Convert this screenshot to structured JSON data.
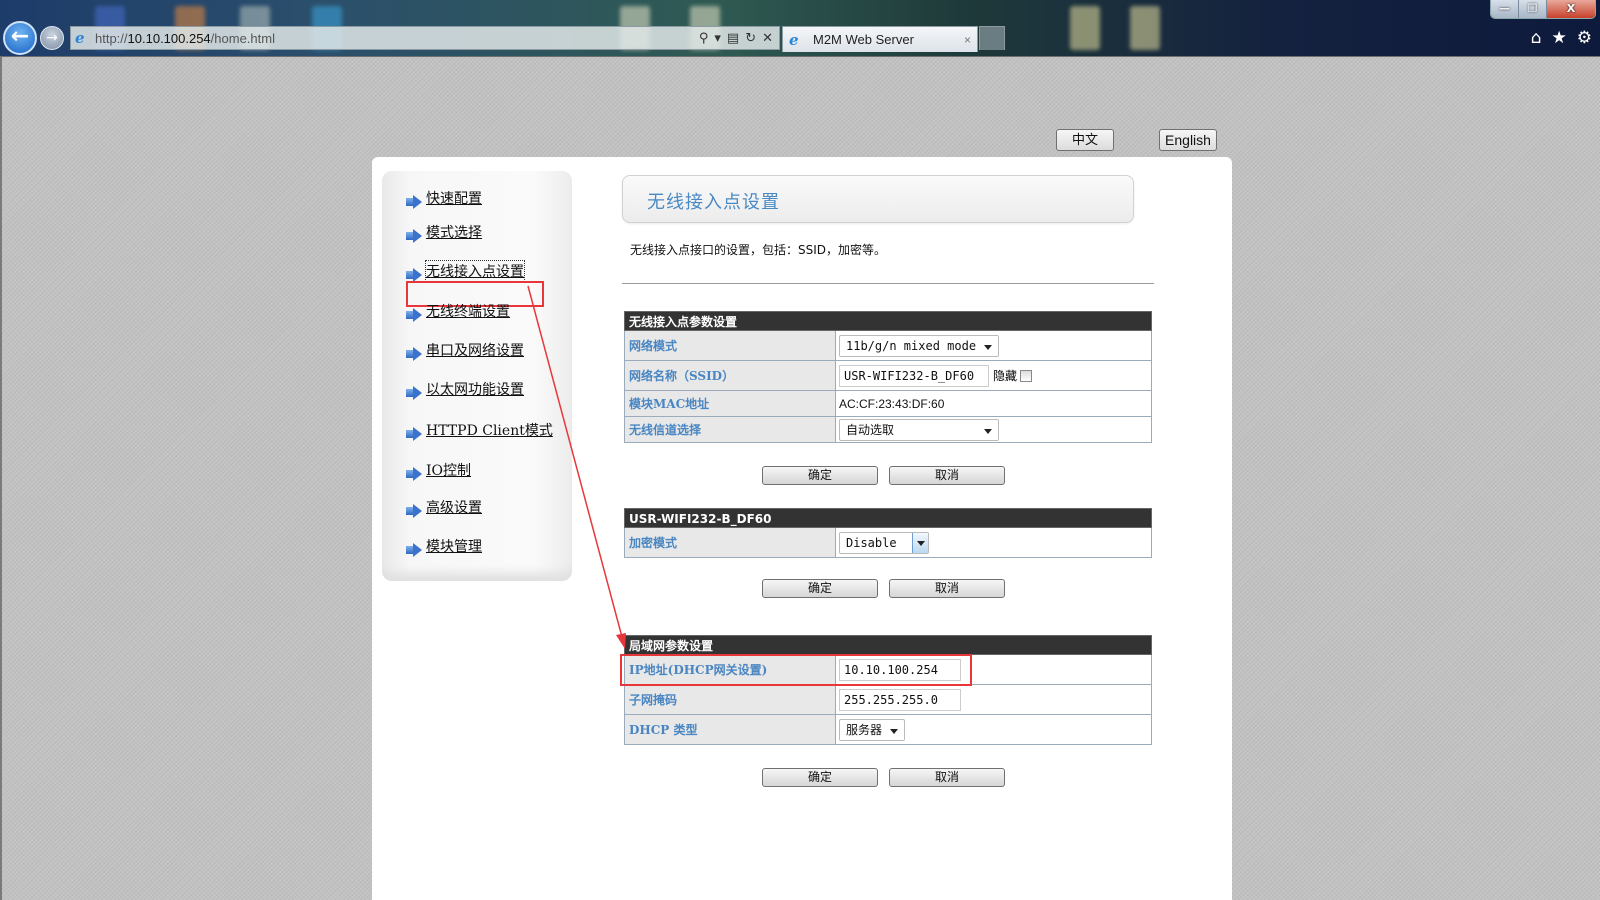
{
  "browser": {
    "url_prefix": "http://",
    "url_host": "10.10.100.254",
    "url_path": "/home.html",
    "tab_title": "M2M Web Server",
    "tab_close": "×",
    "back_glyph": "←",
    "forward_glyph": "→",
    "ie_glyph": "e",
    "addr_tools": {
      "search": "⚲",
      "dropdown": "▾",
      "compat": "▤",
      "refresh": "↻",
      "stop": "✕"
    },
    "window_buttons": {
      "minimize": "—",
      "restore": "❐",
      "close": "X"
    },
    "toolbar_icons": {
      "home": "⌂",
      "favorites": "★",
      "tools": "⚙"
    }
  },
  "language": {
    "chinese": "中文",
    "english": "English"
  },
  "sidebar": {
    "items": [
      {
        "label": "快速配置"
      },
      {
        "label": "模式选择"
      },
      {
        "label": "无线接入点设置",
        "active": true
      },
      {
        "label": "无线终端设置"
      },
      {
        "label": "串口及网络设置"
      },
      {
        "label": "以太网功能设置"
      },
      {
        "label": "HTTPD Client模式"
      },
      {
        "label": "IO控制"
      },
      {
        "label": "高级设置"
      },
      {
        "label": "模块管理"
      }
    ]
  },
  "main": {
    "title": "无线接入点设置",
    "description": "无线接入点接口的设置，包括：SSID，加密等。",
    "ap_section": {
      "header": "无线接入点参数设置",
      "network_mode_label": "网络模式",
      "network_mode_value": "11b/g/n mixed mode",
      "ssid_label": "网络名称（SSID）",
      "ssid_value": "USR-WIFI232-B_DF60",
      "hide_label": "隐藏",
      "hide_checked": false,
      "mac_label": "模块MAC地址",
      "mac_value": "AC:CF:23:43:DF:60",
      "channel_label": "无线信道选择",
      "channel_value": "自动选取",
      "ok": "确定",
      "cancel": "取消"
    },
    "security_section": {
      "header": "USR-WIFI232-B_DF60",
      "encryption_label": "加密模式",
      "encryption_value": "Disable",
      "ok": "确定",
      "cancel": "取消"
    },
    "lan_section": {
      "header": "局域网参数设置",
      "ip_label": "IP地址(DHCP网关设置)",
      "ip_value": "10.10.100.254",
      "mask_label": "子网掩码",
      "mask_value": "255.255.255.0",
      "dhcp_label": "DHCP 类型",
      "dhcp_value": "服务器",
      "ok": "确定",
      "cancel": "取消"
    }
  },
  "annotation": {
    "color": "#e8373a"
  }
}
